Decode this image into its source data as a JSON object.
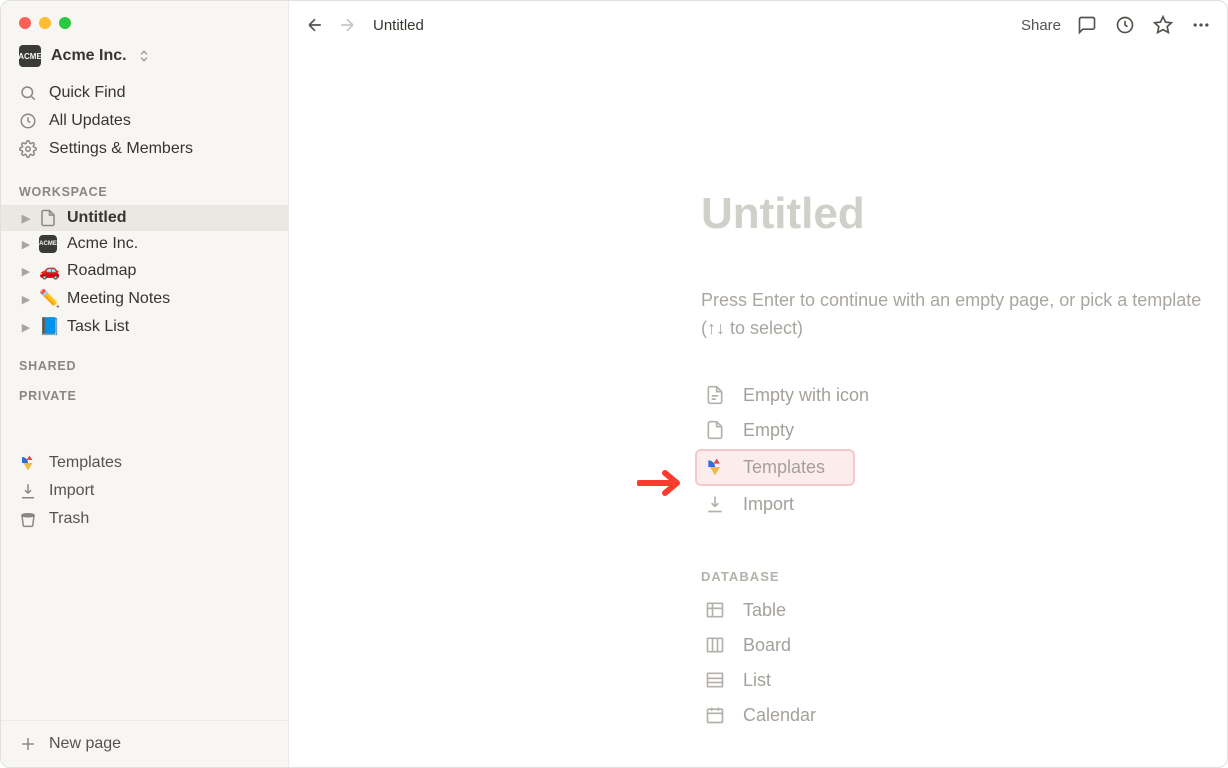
{
  "workspace": {
    "name": "Acme Inc.",
    "badge_text": "ACME"
  },
  "sidebar": {
    "quick_find": "Quick Find",
    "all_updates": "All Updates",
    "settings": "Settings & Members",
    "section_workspace": "WORKSPACE",
    "section_shared": "SHARED",
    "section_private": "PRIVATE",
    "templates": "Templates",
    "import": "Import",
    "trash": "Trash",
    "new_page": "New page",
    "pages": [
      {
        "icon": "page",
        "label": "Untitled",
        "selected": true
      },
      {
        "icon": "badge",
        "label": "Acme Inc."
      },
      {
        "icon": "🚗",
        "label": "Roadmap"
      },
      {
        "icon": "✏️",
        "label": "Meeting Notes"
      },
      {
        "icon": "📘",
        "label": "Task List"
      }
    ]
  },
  "topbar": {
    "breadcrumb": "Untitled",
    "share": "Share"
  },
  "page": {
    "title": "Untitled",
    "prompt": "Press Enter to continue with an empty page, or pick a template (↑↓ to select)",
    "options": [
      {
        "key": "empty_icon",
        "label": "Empty with icon"
      },
      {
        "key": "empty",
        "label": "Empty"
      },
      {
        "key": "templates",
        "label": "Templates",
        "highlight": true
      },
      {
        "key": "import",
        "label": "Import"
      }
    ],
    "db_header": "DATABASE",
    "db_options": [
      {
        "key": "table",
        "label": "Table"
      },
      {
        "key": "board",
        "label": "Board"
      },
      {
        "key": "list",
        "label": "List"
      },
      {
        "key": "calendar",
        "label": "Calendar"
      }
    ]
  }
}
